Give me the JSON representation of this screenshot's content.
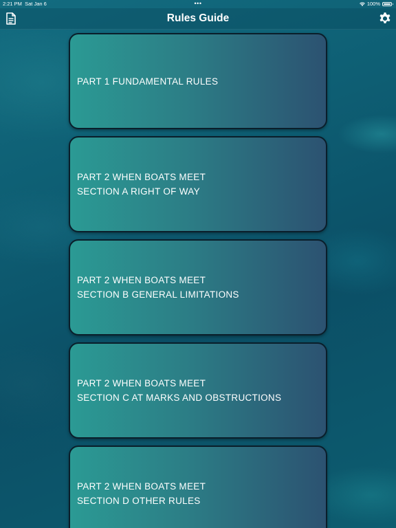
{
  "status_bar": {
    "time": "2:21 PM",
    "date": "Sat Jan 6",
    "center_dots": "•••",
    "battery_percent": "100%",
    "icons": [
      "wifi-icon",
      "battery-icon"
    ]
  },
  "nav": {
    "title": "Rules Guide",
    "left_icon": "document-icon",
    "right_icon": "gear-icon"
  },
  "cards": [
    {
      "line1": "PART 1 FUNDAMENTAL RULES",
      "line2": ""
    },
    {
      "line1": "PART 2 WHEN BOATS MEET",
      "line2": "SECTION A RIGHT OF WAY"
    },
    {
      "line1": "PART 2 WHEN BOATS MEET",
      "line2": "SECTION B GENERAL LIMITATIONS"
    },
    {
      "line1": "PART 2 WHEN BOATS MEET",
      "line2": "SECTION C AT MARKS AND OBSTRUCTIONS"
    },
    {
      "line1": "PART 2 WHEN BOATS MEET",
      "line2": "SECTION D OTHER RULES"
    }
  ],
  "colors": {
    "background": "#0e5f74",
    "card_gradient_start": "#2b9a94",
    "card_gradient_end": "#2c5271",
    "card_border": "#0a1e2a",
    "text": "#ffffff"
  }
}
